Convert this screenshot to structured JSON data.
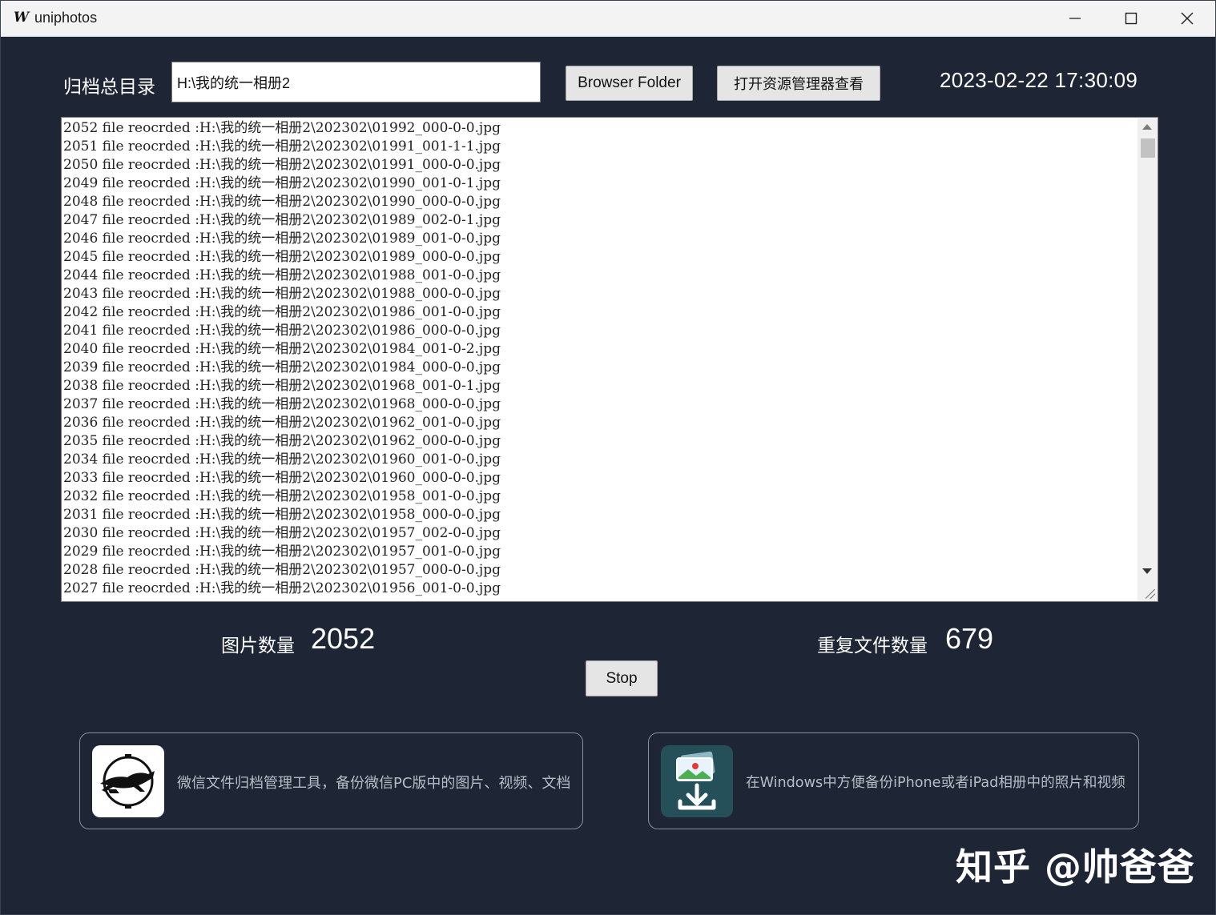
{
  "window": {
    "app_icon_glyph": "W",
    "title": "uniphotos",
    "controls": [
      "minimize-icon",
      "maximize-icon",
      "close-icon"
    ]
  },
  "header": {
    "archive_label": "归档总目录",
    "path_value": "H:\\我的统一相册2",
    "browse_button": "Browser Folder",
    "explorer_button": "打开资源管理器查看",
    "datetime": "2023-02-22 17:30:09"
  },
  "log": {
    "lines": [
      "2052 file reocrded :H:\\我的统一相册2\\202302\\01992_000-0-0.jpg",
      "2051 file reocrded :H:\\我的统一相册2\\202302\\01991_001-1-1.jpg",
      "2050 file reocrded :H:\\我的统一相册2\\202302\\01991_000-0-0.jpg",
      "2049 file reocrded :H:\\我的统一相册2\\202302\\01990_001-0-1.jpg",
      "2048 file reocrded :H:\\我的统一相册2\\202302\\01990_000-0-0.jpg",
      "2047 file reocrded :H:\\我的统一相册2\\202302\\01989_002-0-1.jpg",
      "2046 file reocrded :H:\\我的统一相册2\\202302\\01989_001-0-0.jpg",
      "2045 file reocrded :H:\\我的统一相册2\\202302\\01989_000-0-0.jpg",
      "2044 file reocrded :H:\\我的统一相册2\\202302\\01988_001-0-0.jpg",
      "2043 file reocrded :H:\\我的统一相册2\\202302\\01988_000-0-0.jpg",
      "2042 file reocrded :H:\\我的统一相册2\\202302\\01986_001-0-0.jpg",
      "2041 file reocrded :H:\\我的统一相册2\\202302\\01986_000-0-0.jpg",
      "2040 file reocrded :H:\\我的统一相册2\\202302\\01984_001-0-2.jpg",
      "2039 file reocrded :H:\\我的统一相册2\\202302\\01984_000-0-0.jpg",
      "2038 file reocrded :H:\\我的统一相册2\\202302\\01968_001-0-1.jpg",
      "2037 file reocrded :H:\\我的统一相册2\\202302\\01968_000-0-0.jpg",
      "2036 file reocrded :H:\\我的统一相册2\\202302\\01962_001-0-0.jpg",
      "2035 file reocrded :H:\\我的统一相册2\\202302\\01962_000-0-0.jpg",
      "2034 file reocrded :H:\\我的统一相册2\\202302\\01960_001-0-0.jpg",
      "2033 file reocrded :H:\\我的统一相册2\\202302\\01960_000-0-0.jpg",
      "2032 file reocrded :H:\\我的统一相册2\\202302\\01958_001-0-0.jpg",
      "2031 file reocrded :H:\\我的统一相册2\\202302\\01958_000-0-0.jpg",
      "2030 file reocrded :H:\\我的统一相册2\\202302\\01957_002-0-0.jpg",
      "2029 file reocrded :H:\\我的统一相册2\\202302\\01957_001-0-0.jpg",
      "2028 file reocrded :H:\\我的统一相册2\\202302\\01957_000-0-0.jpg",
      "2027 file reocrded :H:\\我的统一相册2\\202302\\01956_001-0-0.jpg"
    ]
  },
  "stats": {
    "photos_label": "图片数量",
    "photos_value": "2052",
    "duplicates_label": "重复文件数量",
    "duplicates_value": "679"
  },
  "actions": {
    "stop_button": "Stop"
  },
  "promos": [
    {
      "icon": "greyhound-clock-icon",
      "text": "微信文件归档管理工具，备份微信PC版中的图片、视频、文档"
    },
    {
      "icon": "photo-download-icon",
      "text": "在Windows中方便备份iPhone或者iPad相册中的照片和视频"
    }
  ],
  "watermark": "知乎 @帅爸爸"
}
